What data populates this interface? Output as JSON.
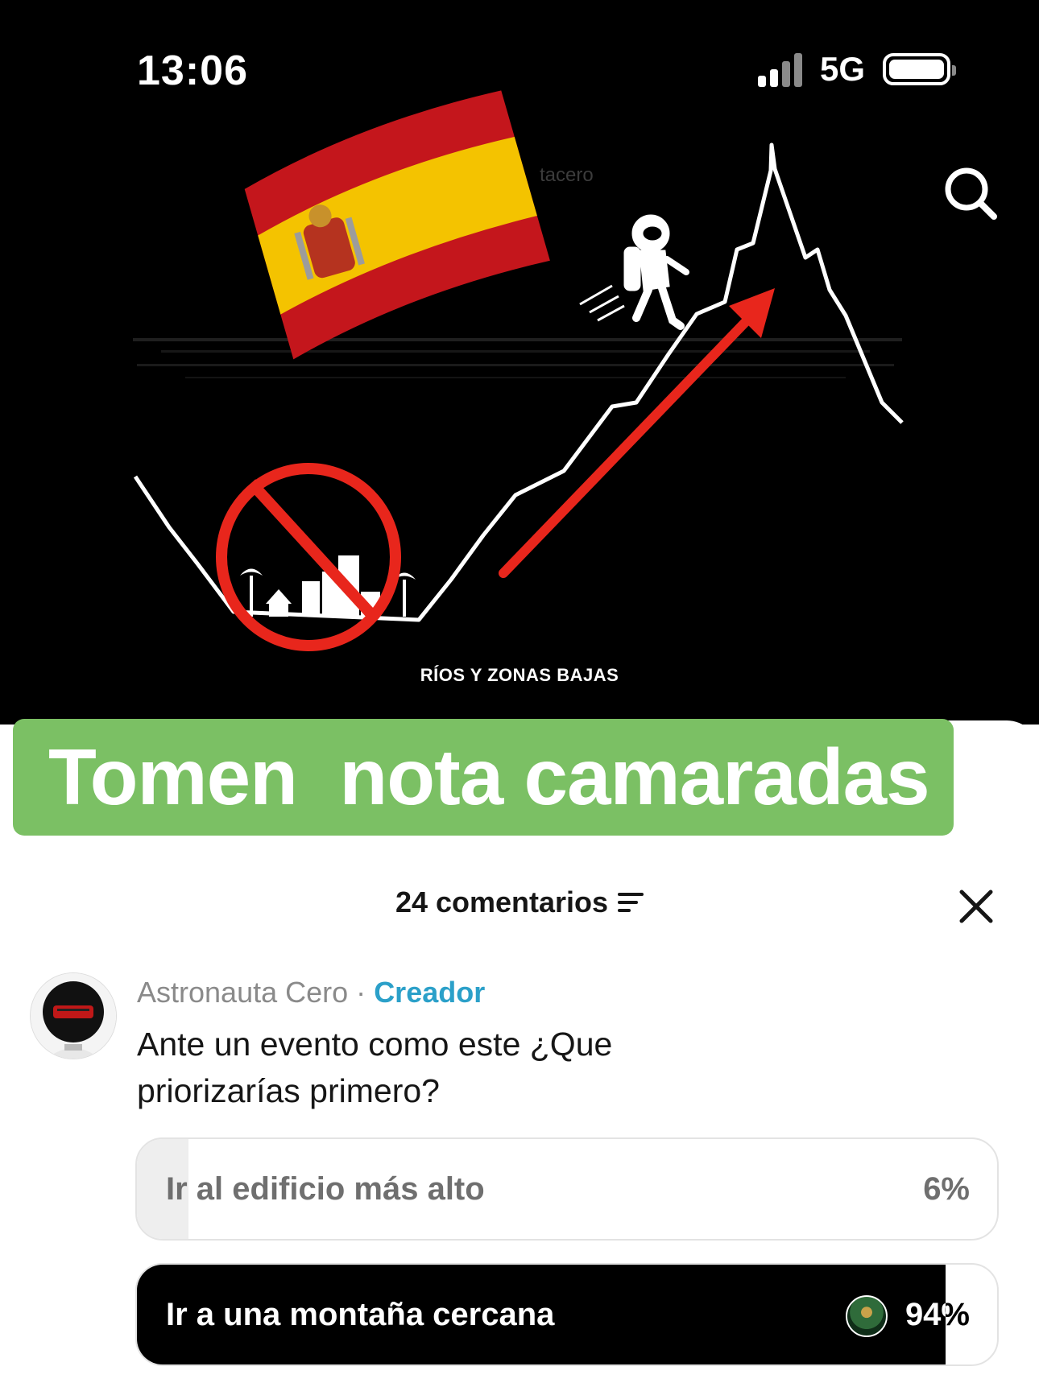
{
  "status_bar": {
    "time": "13:06",
    "network": "5G"
  },
  "video": {
    "watermark": "tacero",
    "scene_label": "RÍOS Y ZONAS BAJAS",
    "overlay_text": "Tomen  nota camaradas"
  },
  "comments": {
    "title": "24 comentarios",
    "items": [
      {
        "author": "Astronauta Cero",
        "separator": "·",
        "badge": "Creador",
        "text": "Ante un evento como este ¿Que priorizarías primero?",
        "poll": {
          "options": [
            {
              "label": "Ir al edificio más alto",
              "percent_text": "6%",
              "percent": 6
            },
            {
              "label": "Ir a una montaña cercana",
              "percent_text": "94%",
              "percent": 94
            }
          ]
        }
      }
    ]
  },
  "colors": {
    "banner": "#7bc064",
    "creator": "#2ba0c9",
    "red_mark": "#e8261c"
  },
  "icons": [
    "signal-icon",
    "battery-icon",
    "search-icon",
    "filter-icon",
    "close-icon",
    "spain-flag-icon",
    "no-entry-icon",
    "arrow-icon",
    "astronaut-icon"
  ]
}
